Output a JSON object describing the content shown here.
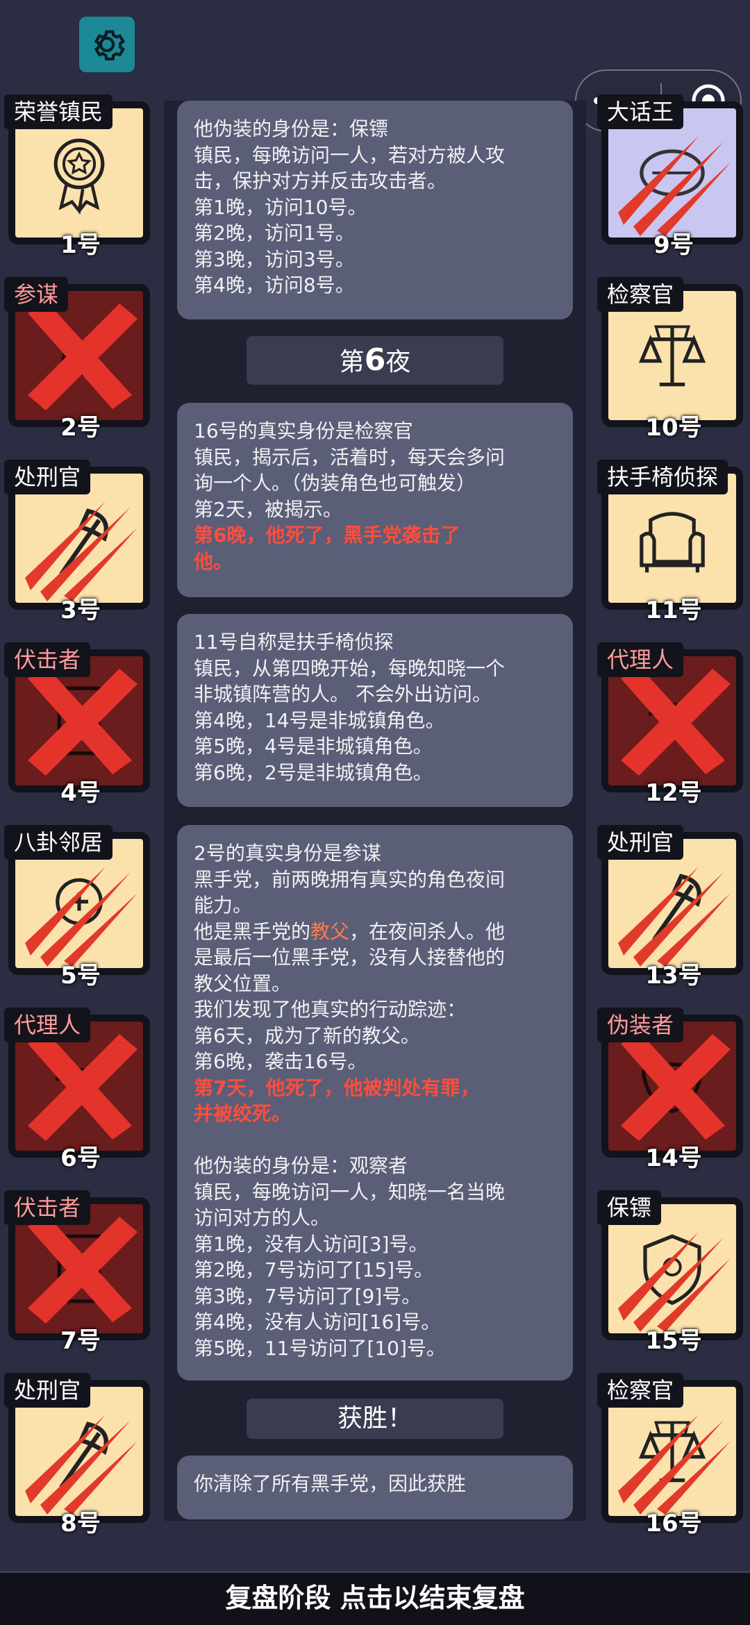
{
  "players_left": [
    {
      "role": "荣誉镇民",
      "num": "1号",
      "state": "alive",
      "faction": "good",
      "icon": "medal-icon"
    },
    {
      "role": "参谋",
      "num": "2号",
      "state": "dead-x",
      "faction": "evil",
      "icon": "hat-icon"
    },
    {
      "role": "处刑官",
      "num": "3号",
      "state": "claw",
      "faction": "good",
      "icon": "axe-icon"
    },
    {
      "role": "伏击者",
      "num": "4号",
      "state": "dead-x",
      "faction": "evil",
      "icon": "door-icon"
    },
    {
      "role": "八卦邻居",
      "num": "5号",
      "state": "claw",
      "faction": "good",
      "icon": "badge-icon"
    },
    {
      "role": "代理人",
      "num": "6号",
      "state": "dead-x",
      "faction": "evil",
      "icon": "spy-icon"
    },
    {
      "role": "伏击者",
      "num": "7号",
      "state": "dead-x",
      "faction": "evil",
      "icon": "door-icon"
    },
    {
      "role": "处刑官",
      "num": "8号",
      "state": "claw",
      "faction": "good",
      "icon": "axe-icon"
    }
  ],
  "players_right": [
    {
      "role": "大话王",
      "num": "9号",
      "state": "claw-lavender",
      "faction": "good",
      "icon": "mouth-icon"
    },
    {
      "role": "检察官",
      "num": "10号",
      "state": "alive",
      "faction": "good",
      "icon": "scales-icon"
    },
    {
      "role": "扶手椅侦探",
      "num": "11号",
      "state": "alive",
      "faction": "good",
      "icon": "armchair-icon"
    },
    {
      "role": "代理人",
      "num": "12号",
      "state": "dead-x",
      "faction": "evil",
      "icon": "spy-icon"
    },
    {
      "role": "处刑官",
      "num": "13号",
      "state": "claw",
      "faction": "good",
      "icon": "axe-icon"
    },
    {
      "role": "伪装者",
      "num": "14号",
      "state": "dead-x",
      "faction": "evil",
      "icon": "mask-icon"
    },
    {
      "role": "保镖",
      "num": "15号",
      "state": "claw",
      "faction": "good",
      "icon": "shield-icon"
    },
    {
      "role": "检察官",
      "num": "16号",
      "state": "claw",
      "faction": "good",
      "icon": "scales-icon"
    }
  ],
  "log": {
    "msg1": [
      "他伪装的身份是：保镖",
      "镇民，每晚访问一人，若对方被人攻",
      "击，保护对方并反击攻击者。",
      "第1晚，访问10号。",
      "第2晚，访问1号。",
      "第3晚，访问3号。",
      "第4晚，访问8号。"
    ],
    "phase1_pre": "第",
    "phase1_num": "6",
    "phase1_post": "夜",
    "msg2": [
      "16号的真实身份是检察官",
      "镇民，揭示后，活着时，每天会多问",
      "询一个人。（伪装角色也可触发）",
      "第2天，被揭示。"
    ],
    "msg2_red": [
      "第6晚，他死了，黑手党袭击了",
      "他。"
    ],
    "msg3": [
      "11号自称是扶手椅侦探",
      "镇民，从第四晚开始，每晚知晓一个",
      "非城镇阵营的人。 不会外出访问。",
      "第4晚，14号是非城镇角色。",
      "第5晚，4号是非城镇角色。",
      "第6晚，2号是非城镇角色。"
    ],
    "msg4_a": [
      "2号的真实身份是参谋",
      "黑手党，前两晚拥有真实的角色夜间",
      "能力。"
    ],
    "msg4_b_pre": "他是黑手党的",
    "msg4_b_hl": "教父",
    "msg4_b_post": "，在夜间杀人。他",
    "msg4_c": [
      "是最后一位黑手党，没有人接替他的",
      "教父位置。",
      "我们发现了他真实的行动踪迹：",
      "第6天，成为了新的教父。",
      "第6晚，袭击16号。"
    ],
    "msg4_red": [
      "第7天，他死了，他被判处有罪，",
      "并被绞死。"
    ],
    "msg4_d": [
      "",
      "他伪装的身份是：观察者",
      "镇民，每晚访问一人，知晓一名当晚",
      "访问对方的人。",
      "第1晚，没有人访问[3]号。",
      "第2晚，7号访问了[15]号。",
      "第3晚，7号访问了[9]号。",
      "第4晚，没有人访问[16]号。",
      "第5晚，11号访问了[10]号。"
    ],
    "phase2": "获胜！",
    "msg5": "你清除了所有黑手党，因此获胜"
  },
  "footer": "复盘阶段 点击以结束复盘",
  "colors": {
    "background": "#2b2d42",
    "message": "#5b5e77",
    "highlight_red": "#ff4d3c",
    "alive_card": "#fbe2ad",
    "dead_card": "#6b1c1c"
  }
}
